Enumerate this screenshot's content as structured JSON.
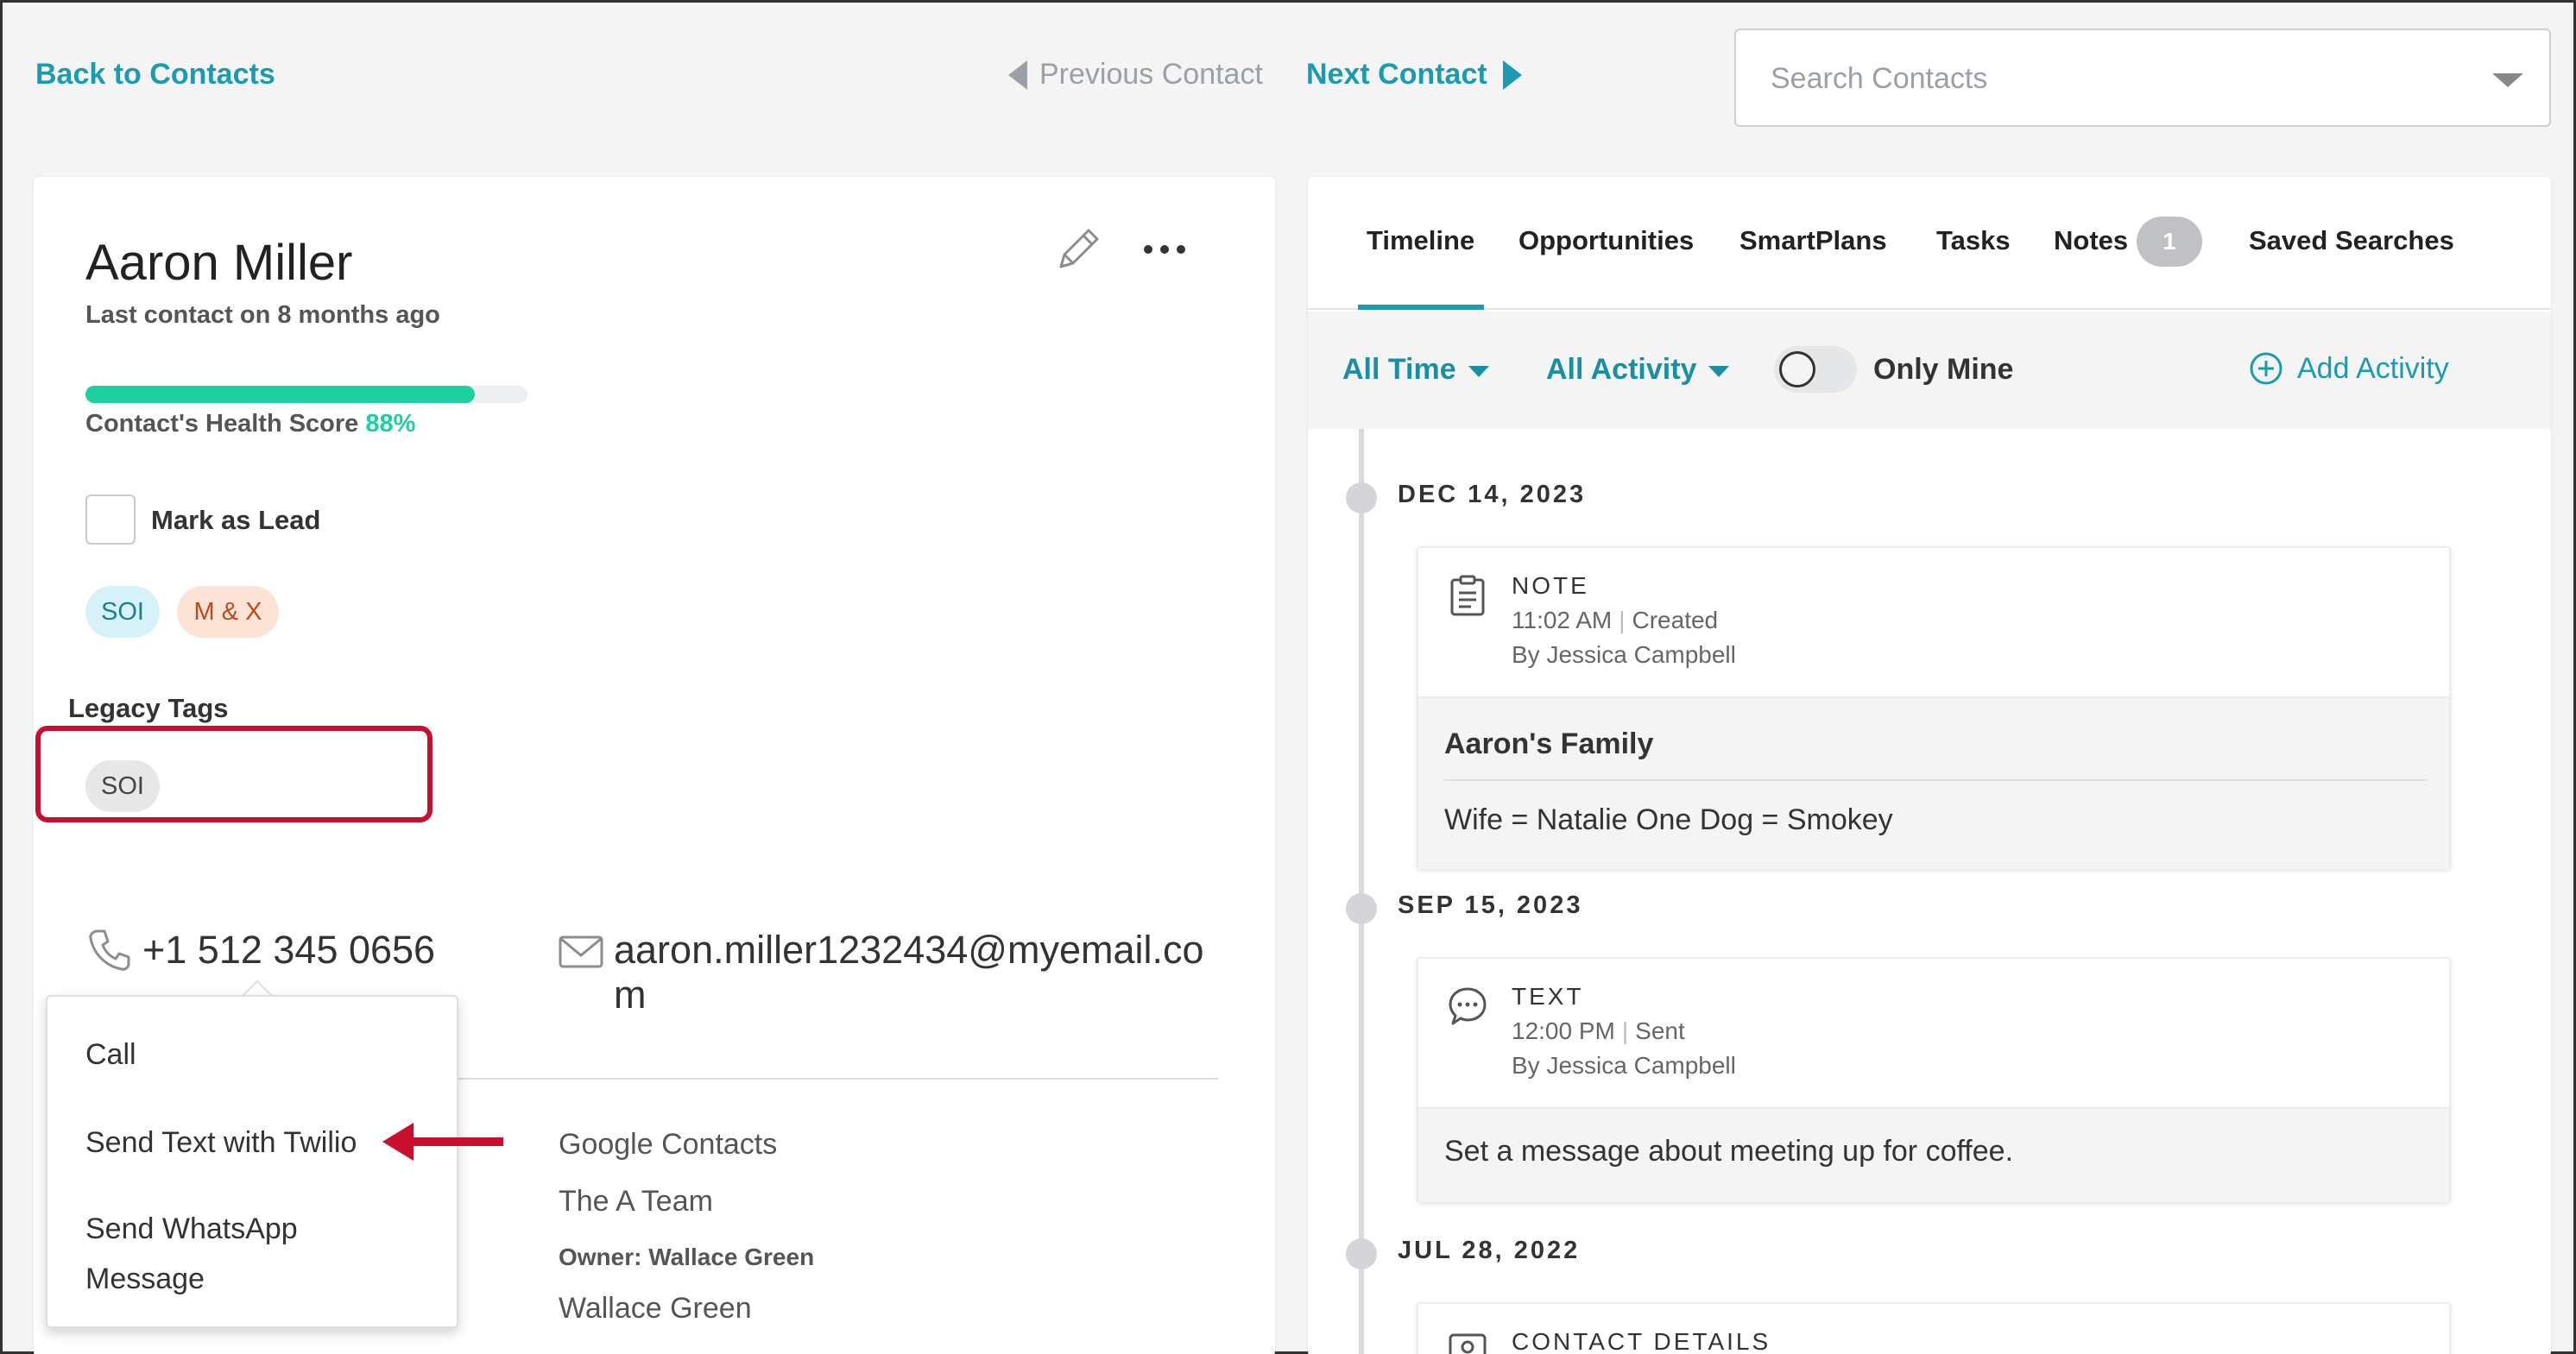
{
  "nav": {
    "back": "Back to Contacts",
    "previous": "Previous Contact",
    "next": "Next Contact",
    "search_placeholder": "Search Contacts"
  },
  "contact": {
    "name": "Aaron Miller",
    "last_contact": "Last contact on 8 months ago",
    "health_label": "Contact's Health Score",
    "health_score": "88%",
    "health_fraction": 0.88,
    "mark_as_lead": "Mark as Lead",
    "tags": [
      "SOI",
      "M & X"
    ],
    "legacy_tags_title": "Legacy Tags",
    "legacy_tags": [
      "SOI"
    ],
    "phone": "+1 512 345 0656",
    "email": "aaron.miller1232434@myemail.com",
    "source": "Google Contacts",
    "team": "The A Team",
    "owner_label": "Owner: Wallace Green",
    "owner_name": "Wallace Green"
  },
  "phone_menu": {
    "items": [
      "Call",
      "Send Text with Twilio",
      "Send WhatsApp Message"
    ]
  },
  "tabs": {
    "timeline": "Timeline",
    "opportunities": "Opportunities",
    "smartplans": "SmartPlans",
    "tasks": "Tasks",
    "notes": "Notes",
    "notes_count": "1",
    "saved_searches": "Saved Searches"
  },
  "filters": {
    "time": "All Time",
    "activity": "All Activity",
    "only_mine": "Only Mine",
    "add_activity": "Add Activity"
  },
  "timeline": {
    "groups": [
      {
        "date": "DEC 14, 2023",
        "type": "NOTE",
        "time": "11:02 AM",
        "status": "Created",
        "by": "By Jessica Campbell",
        "title": "Aaron's Family",
        "text": "Wife = Natalie One Dog = Smokey"
      },
      {
        "date": "SEP 15, 2023",
        "type": "TEXT",
        "time": "12:00 PM",
        "status": "Sent",
        "by": "By Jessica Campbell",
        "text": "Set a message about meeting up for coffee."
      },
      {
        "date": "JUL 28, 2022",
        "type": "CONTACT DETAILS"
      }
    ]
  },
  "colors": {
    "accent": "#1a9bb0",
    "health": "#1ecfa0",
    "highlight": "#c8102e"
  }
}
